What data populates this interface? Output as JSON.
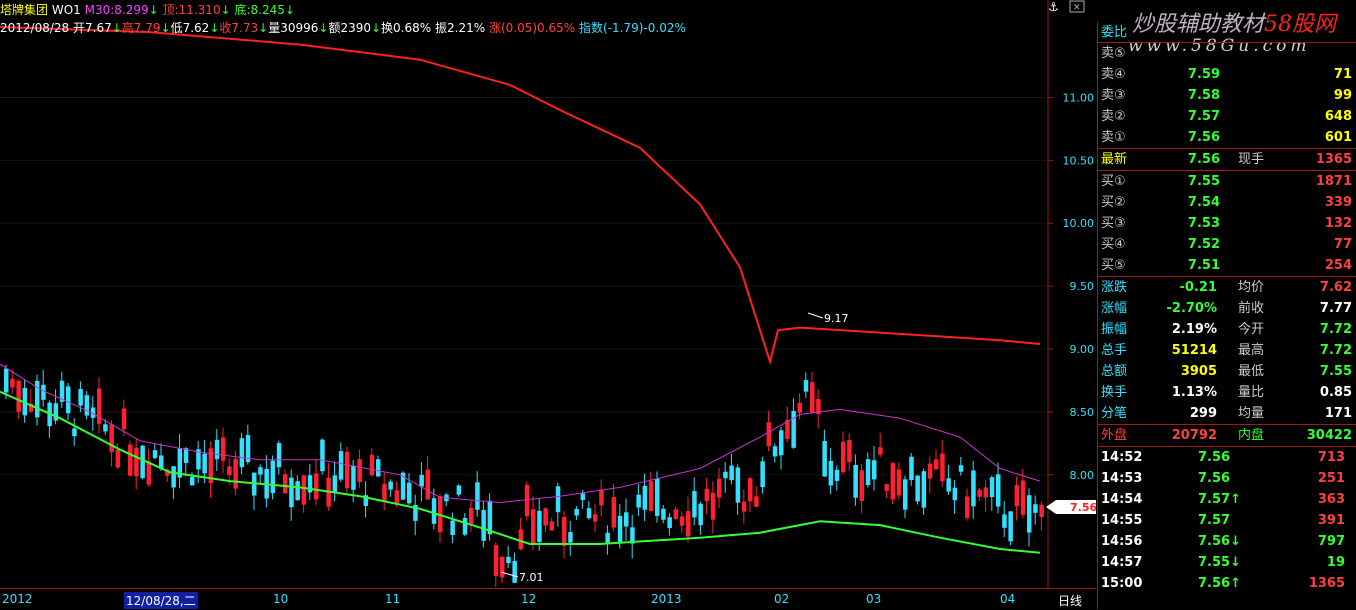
{
  "header": {
    "stock_name": "塔牌集团",
    "indicator_name": "WO1",
    "m30": "M30:8.299",
    "top": "顶:11.310",
    "bottom": "底:8.245",
    "date": "2012/08/28",
    "open": "开7.67",
    "high": "高7.79",
    "low": "低7.62",
    "close": "收7.73",
    "volume": "量30996",
    "amount": "额2390",
    "turnover": "换0.68%",
    "amplitude": "振2.21%",
    "change": "涨(0.05)0.65%",
    "index": "指数(-1.79)-0.02%",
    "arrow_icon": "down-arrow"
  },
  "watermark": {
    "line1_a": "炒股辅助教材",
    "line1_b": "58股网",
    "line2": "www.58Gu.com"
  },
  "chart_data": {
    "type": "candlestick",
    "y_ticks": [
      "11.00",
      "10.50",
      "10.00",
      "9.50",
      "9.00",
      "8.50",
      "8.00"
    ],
    "y_range": [
      7.1,
      11.6
    ],
    "x_labels": [
      "2012",
      "12/08/28,二",
      "10",
      "11",
      "12",
      "2013",
      "02",
      "03",
      "04",
      "日线"
    ],
    "annotations": {
      "high_label": "9.17",
      "low_label": "7.01"
    },
    "current_price_tag": "7.56",
    "series": [
      {
        "name": "top_line",
        "color": "#ff2020",
        "points": [
          [
            0,
            11.56
          ],
          [
            150,
            11.52
          ],
          [
            300,
            11.42
          ],
          [
            420,
            11.3
          ],
          [
            510,
            11.1
          ],
          [
            560,
            10.9
          ],
          [
            640,
            10.6
          ],
          [
            700,
            10.15
          ],
          [
            740,
            9.65
          ],
          [
            770,
            8.9
          ],
          [
            778,
            9.15
          ],
          [
            800,
            9.17
          ],
          [
            900,
            9.12
          ],
          [
            1000,
            9.07
          ],
          [
            1040,
            9.04
          ]
        ]
      },
      {
        "name": "m30",
        "color": "#cc33cc",
        "points": [
          [
            0,
            8.88
          ],
          [
            40,
            8.68
          ],
          [
            90,
            8.5
          ],
          [
            140,
            8.27
          ],
          [
            200,
            8.18
          ],
          [
            260,
            8.12
          ],
          [
            320,
            8.12
          ],
          [
            400,
            8.0
          ],
          [
            440,
            7.82
          ],
          [
            500,
            7.78
          ],
          [
            560,
            7.83
          ],
          [
            620,
            7.9
          ],
          [
            700,
            8.05
          ],
          [
            760,
            8.3
          ],
          [
            800,
            8.48
          ],
          [
            840,
            8.52
          ],
          [
            900,
            8.45
          ],
          [
            960,
            8.3
          ],
          [
            1000,
            8.05
          ],
          [
            1040,
            7.95
          ]
        ]
      },
      {
        "name": "bottom_line",
        "color": "#33ff33",
        "points": [
          [
            0,
            8.66
          ],
          [
            60,
            8.45
          ],
          [
            120,
            8.2
          ],
          [
            170,
            8.02
          ],
          [
            230,
            7.95
          ],
          [
            300,
            7.9
          ],
          [
            360,
            7.83
          ],
          [
            420,
            7.73
          ],
          [
            480,
            7.58
          ],
          [
            530,
            7.45
          ],
          [
            600,
            7.45
          ],
          [
            700,
            7.5
          ],
          [
            760,
            7.54
          ],
          [
            820,
            7.63
          ],
          [
            880,
            7.6
          ],
          [
            940,
            7.5
          ],
          [
            1000,
            7.41
          ],
          [
            1040,
            7.38
          ]
        ]
      }
    ]
  },
  "panel": {
    "title": "委比",
    "sell": [
      {
        "label": "卖⑤",
        "price": "",
        "vol": ""
      },
      {
        "label": "卖④",
        "price": "7.59",
        "vol": "71"
      },
      {
        "label": "卖③",
        "price": "7.58",
        "vol": "99"
      },
      {
        "label": "卖②",
        "price": "7.57",
        "vol": "648"
      },
      {
        "label": "卖①",
        "price": "7.56",
        "vol": "601"
      }
    ],
    "latest": {
      "label": "最新",
      "price": "7.56",
      "label2": "现手",
      "vol": "1365"
    },
    "buy": [
      {
        "label": "买①",
        "price": "7.55",
        "vol": "1871"
      },
      {
        "label": "买②",
        "price": "7.54",
        "vol": "339"
      },
      {
        "label": "买③",
        "price": "7.53",
        "vol": "132"
      },
      {
        "label": "买④",
        "price": "7.52",
        "vol": "77"
      },
      {
        "label": "买⑤",
        "price": "7.51",
        "vol": "254"
      }
    ],
    "stats": [
      {
        "l1": "涨跌",
        "v1": "-0.21",
        "l2": "均价",
        "v2": "7.62"
      },
      {
        "l1": "涨幅",
        "v1": "-2.70%",
        "l2": "前收",
        "v2": "7.77"
      },
      {
        "l1": "振幅",
        "v1": "2.19%",
        "l2": "今开",
        "v2": "7.72"
      },
      {
        "l1": "总手",
        "v1": "51214",
        "l2": "最高",
        "v2": "7.72"
      },
      {
        "l1": "总额",
        "v1": "3905",
        "l2": "最低",
        "v2": "7.55"
      },
      {
        "l1": "换手",
        "v1": "1.13%",
        "l2": "量比",
        "v2": "0.85"
      },
      {
        "l1": "分笔",
        "v1": "299",
        "l2": "均量",
        "v2": "171"
      }
    ],
    "outer": {
      "l1": "外盘",
      "v1": "20792",
      "l2": "内盘",
      "v2": "30422"
    },
    "ticks": [
      {
        "time": "14:52",
        "price": "7.56",
        "vol": "713",
        "arrow": ""
      },
      {
        "time": "14:53",
        "price": "7.56",
        "vol": "251",
        "arrow": ""
      },
      {
        "time": "14:54",
        "price": "7.57↑",
        "vol": "363",
        "arrow": "up"
      },
      {
        "time": "14:55",
        "price": "7.57",
        "vol": "391",
        "arrow": ""
      },
      {
        "time": "14:56",
        "price": "7.56↓",
        "vol": "797",
        "arrow": "down"
      },
      {
        "time": "14:57",
        "price": "7.55↓",
        "vol": "19",
        "arrow": "down"
      },
      {
        "time": "15:00",
        "price": "7.56↑",
        "vol": "1365",
        "arrow": "up"
      }
    ]
  }
}
